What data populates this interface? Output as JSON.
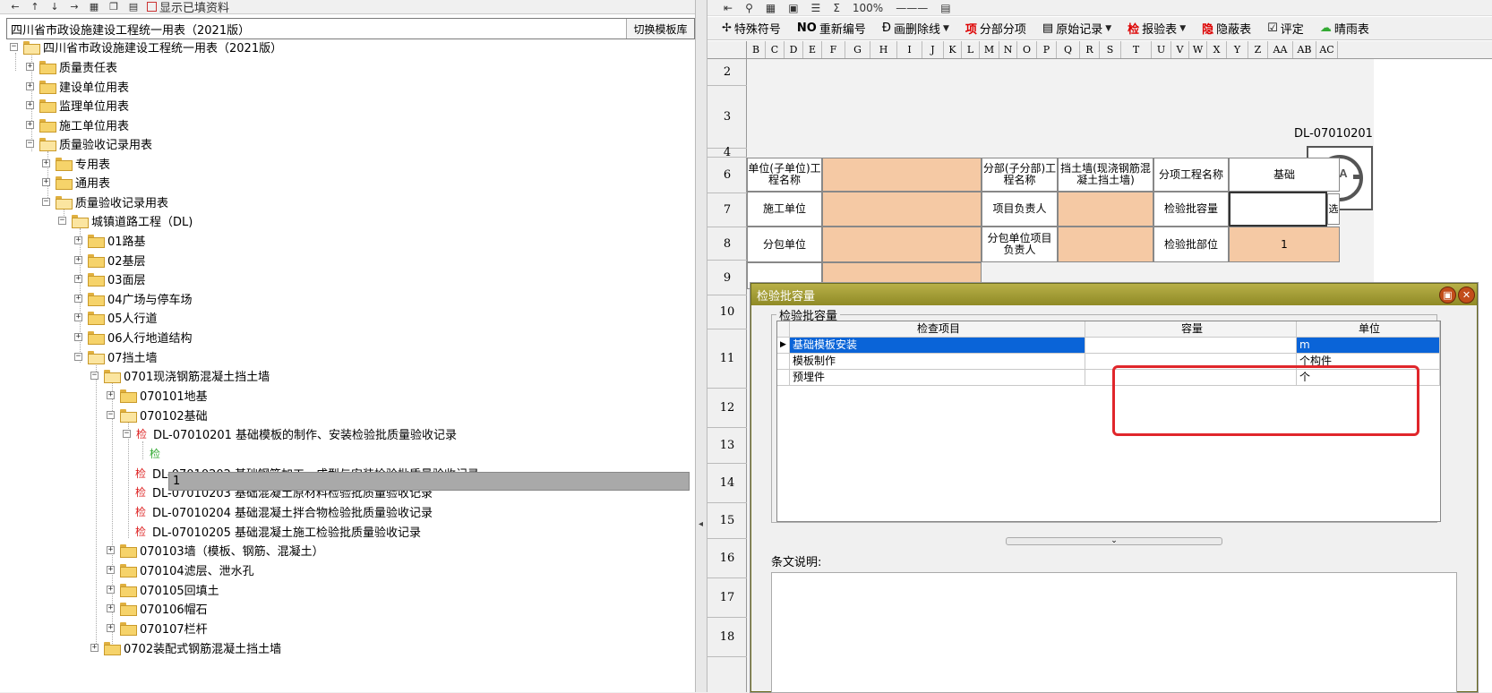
{
  "left_toolbar": {
    "show_filled": "显示已填资料"
  },
  "library": {
    "title": "四川省市政设施建设工程统一用表（2021版）",
    "switch_label": "切换模板库"
  },
  "tree": {
    "root": "四川省市政设施建设工程统一用表（2021版）",
    "n1": "质量责任表",
    "n2": "建设单位用表",
    "n3": "监理单位用表",
    "n4": "施工单位用表",
    "n5": "质量验收记录用表",
    "n5a": "专用表",
    "n5b": "通用表",
    "n5c": "质量验收记录用表",
    "dl": "城镇道路工程（DL)",
    "d01": "01路基",
    "d02": "02基层",
    "d03": "03面层",
    "d04": "04广场与停车场",
    "d05": "05人行道",
    "d06": "06人行地道结构",
    "d07": "07挡土墙",
    "d0701": "0701现浇钢筋混凝土挡土墙",
    "d070101": "070101地基",
    "d070102": "070102基础",
    "rec1": "DL-07010201 基础模板的制作、安装检验批质量验收记录",
    "rec1_child": "1",
    "rec2": "DL-07010202 基础钢筋加工、成型与安装检验批质量验收记录",
    "rec3": "DL-07010203 基础混凝土原材料检验批质量验收记录",
    "rec4": "DL-07010204 基础混凝土拌合物检验批质量验收记录",
    "rec5": "DL-07010205 基础混凝土施工检验批质量验收记录",
    "d070103": "070103墙（模板、钢筋、混凝土）",
    "d070104": "070104滤层、泄水孔",
    "d070105": "070105回填土",
    "d070106": "070106帽石",
    "d070107": "070107栏杆",
    "d0702": "0702装配式钢筋混凝土挡土墙",
    "check_mark": "检"
  },
  "right_toolbar": {
    "zoom": "100%",
    "special_symbol": "特殊符号",
    "renumber": "重新编号",
    "strike": "画删除线",
    "sub_item": "分部分项",
    "original": "原始记录",
    "report": "报验表",
    "hide": "隐蔽表",
    "rating": "评定",
    "weather": "晴雨表",
    "renumber_prefix": "NO",
    "sub_item_prefix": "项",
    "report_prefix": "检",
    "hide_prefix": "隐"
  },
  "columns": [
    "B",
    "C",
    "D",
    "E",
    "F",
    "G",
    "H",
    "I",
    "J",
    "K",
    "L",
    "M",
    "N",
    "O",
    "P",
    "Q",
    "R",
    "S",
    "T",
    "U",
    "V",
    "W",
    "X",
    "Y",
    "Z",
    "AA",
    "AB",
    "AC"
  ],
  "rows": [
    "2",
    "3",
    "4",
    "6",
    "7",
    "8",
    "9",
    "10",
    "11",
    "12",
    "13",
    "14",
    "15",
    "16",
    "17",
    "18"
  ],
  "sheet": {
    "code": "DL-07010201",
    "title": "基础模板的制作、安装检验批质量验收记录",
    "unit_name_label": "单位(子单位)工程名称",
    "division_label": "分部(子分部)工程名称",
    "division_value": "挡土墙(现浇钢筋混凝土挡土墙)",
    "sub_item_label": "分项工程名称",
    "sub_item_value": "基础",
    "contractor_label": "施工单位",
    "pm_label": "项目负责人",
    "batch_cap_label": "检验批容量",
    "select_btn": "选",
    "subcontractor_label": "分包单位",
    "sub_pm_label": "分包单位项目负责人",
    "batch_part_label": "检验批部位",
    "batch_part_value": "1",
    "logo_text": "ZA"
  },
  "dialog": {
    "title": "检验批容量",
    "group_label": "检验批容量",
    "headers": [
      "检查项目",
      "容量",
      "单位"
    ],
    "rows": [
      {
        "item": "基础模板安装",
        "capacity": "",
        "unit": "m"
      },
      {
        "item": "模板制作",
        "capacity": "",
        "unit": "个构件"
      },
      {
        "item": "预埋件",
        "capacity": "",
        "unit": "个"
      }
    ],
    "note_label": "条文说明:",
    "minimize": "▣",
    "close": "✕"
  }
}
